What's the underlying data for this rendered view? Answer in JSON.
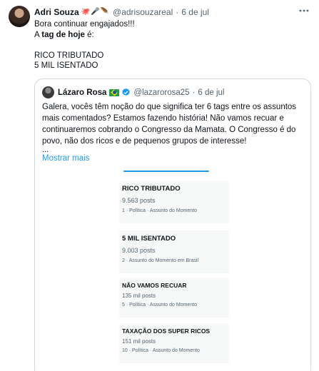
{
  "tweet": {
    "display_name": "Adri Souza",
    "emoji": [
      "🐙",
      "🎤",
      "🪶"
    ],
    "handle": "@adrisouzareal",
    "separator": "·",
    "date": "6 de jul",
    "more_icon": "more-horizontal-icon",
    "lines": {
      "l1": "Bora continuar engajados!!!",
      "l2_prefix": "A ",
      "l2_bold": "tag de hoje",
      "l2_suffix": " é:",
      "l4": "RICO TRIBUTADO",
      "l5": "5 MIL ISENTADO"
    }
  },
  "quote": {
    "display_name": "Lázaro Rosa",
    "flag_icon": "brazil-flag-icon",
    "verified_icon": "verified-badge-icon",
    "handle": "@lazarorosa25",
    "separator": "·",
    "date": "6 de jul",
    "text_lines": [
      "Galera, vocês têm noção do que significa ter 6 tags entre os assuntos",
      "mais comentados? Estamos fazendo história! Não vamos recuar e",
      "continuaremos cobrando o Congresso da Mamata. O Congresso é do",
      "povo, não dos ricos e de pequenos grupos de interesse!"
    ],
    "ellipsis": "...",
    "show_more": "Mostrar mais"
  },
  "trends": [
    {
      "title": "RICO TRIBUTADO",
      "count": "9.563 posts",
      "category": "1 · Política · Assunto do Momento"
    },
    {
      "title": "5 MIL ISENTADO",
      "count": "9.003 posts",
      "category": "2 · Assunto do Momento em Brasil"
    },
    {
      "title": "NÃO VAMOS RECUAR",
      "count": "135 mil posts",
      "category": "5 · Política · Assunto do Momento"
    },
    {
      "title": "TAXAÇÃO DOS SUPER RICOS",
      "count": "151 mil posts",
      "category": "10 · Política · Assunto do Momento"
    }
  ],
  "colors": {
    "link": "#1d9bf0",
    "secondary_text": "#536471",
    "border": "#cfd9de"
  }
}
